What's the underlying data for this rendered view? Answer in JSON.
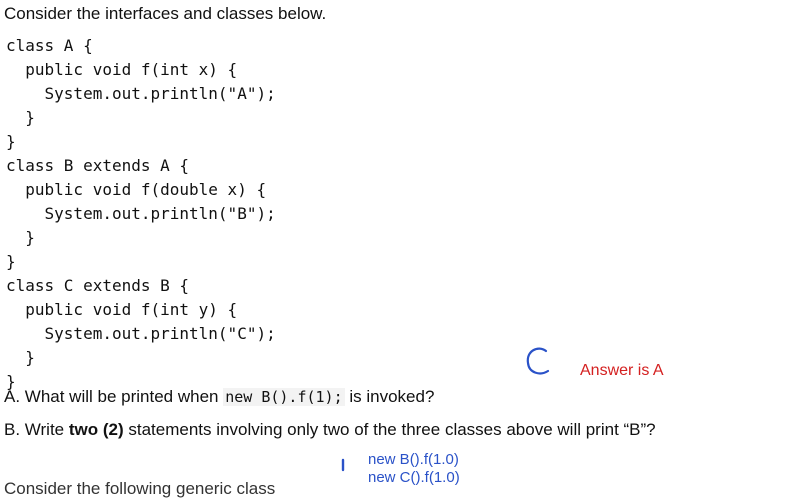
{
  "intro": "Consider the interfaces and classes below.",
  "code_lines": [
    "class A {",
    "  public void f(int x) {",
    "    System.out.println(\"A\");",
    "  }",
    "}",
    "class B extends A {",
    "  public void f(double x) {",
    "    System.out.println(\"B\");",
    "  }",
    "}",
    "class C extends B {",
    "  public void f(int y) {",
    "    System.out.println(\"C\");",
    "  }",
    "}"
  ],
  "question_a": {
    "prefix": "A.  What will be printed when ",
    "code": "new B().f(1);",
    "suffix": " is invoked?"
  },
  "question_b": {
    "prefix": "B.  Write ",
    "bold": "two (2)",
    "suffix": " statements involving only two of the three classes above will print “B”?"
  },
  "annotations": {
    "handwritten_letter": "C",
    "answer_note": "Answer is A",
    "statement_1": "new B().f(1.0)",
    "statement_2": "new C().f(1.0)",
    "answer_color": "#d42020",
    "pen_color": "#2a52c8"
  },
  "next_section": "Consider the following generic class"
}
